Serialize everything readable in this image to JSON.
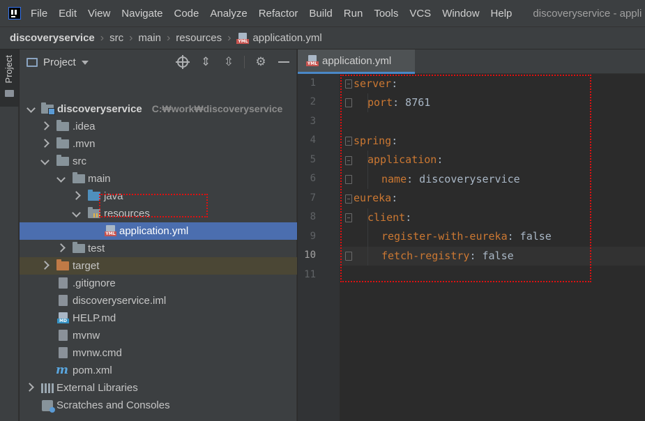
{
  "menubar": {
    "items": [
      "File",
      "Edit",
      "View",
      "Navigate",
      "Code",
      "Analyze",
      "Refactor",
      "Build",
      "Run",
      "Tools",
      "VCS",
      "Window",
      "Help"
    ],
    "window_title": "discoveryservice - appli"
  },
  "breadcrumb": {
    "items": [
      "discoveryservice",
      "src",
      "main",
      "resources",
      "application.yml"
    ]
  },
  "left_stripe": {
    "label": "Project"
  },
  "project_panel": {
    "title": "Project",
    "tree": [
      {
        "label": "discoveryservice",
        "path": "C:₩work₩discoveryservice",
        "icon": "module-folder-icon",
        "expanded": true
      },
      {
        "label": ".idea",
        "icon": "folder-icon",
        "expanded": false
      },
      {
        "label": ".mvn",
        "icon": "folder-icon",
        "expanded": false
      },
      {
        "label": "src",
        "icon": "folder-icon",
        "expanded": true
      },
      {
        "label": "main",
        "icon": "folder-icon",
        "expanded": true
      },
      {
        "label": "java",
        "icon": "source-folder-icon",
        "expanded": false
      },
      {
        "label": "resources",
        "icon": "resources-folder-icon",
        "expanded": true
      },
      {
        "label": "application.yml",
        "icon": "yml-file-icon",
        "selected": true
      },
      {
        "label": "test",
        "icon": "folder-icon",
        "expanded": false
      },
      {
        "label": "target",
        "icon": "excluded-folder-icon",
        "expanded": false
      },
      {
        "label": ".gitignore",
        "icon": "gitignore-file-icon"
      },
      {
        "label": "discoveryservice.iml",
        "icon": "iml-file-icon"
      },
      {
        "label": "HELP.md",
        "icon": "md-file-icon"
      },
      {
        "label": "mvnw",
        "icon": "shell-file-icon"
      },
      {
        "label": "mvnw.cmd",
        "icon": "cmd-file-icon"
      },
      {
        "label": "pom.xml",
        "icon": "maven-icon"
      },
      {
        "label": "External Libraries",
        "icon": "libraries-icon",
        "expanded": false
      },
      {
        "label": "Scratches and Consoles",
        "icon": "scratches-icon"
      }
    ]
  },
  "editor": {
    "tab_label": "application.yml",
    "yml_tag": "YML",
    "md_tag": "MD",
    "current_line": 10,
    "line_numbers": [
      "1",
      "2",
      "3",
      "4",
      "5",
      "6",
      "7",
      "8",
      "9",
      "10",
      "11"
    ],
    "lines": [
      {
        "key": "server",
        "sep": ":",
        "value": ""
      },
      {
        "key": "port",
        "sep": ":",
        "value": " 8761"
      },
      {
        "key": "",
        "sep": "",
        "value": ""
      },
      {
        "key": "spring",
        "sep": ":",
        "value": ""
      },
      {
        "key": "application",
        "sep": ":",
        "value": ""
      },
      {
        "key": "name",
        "sep": ":",
        "value": " discoveryservice"
      },
      {
        "key": "eureka",
        "sep": ":",
        "value": ""
      },
      {
        "key": "client",
        "sep": ":",
        "value": ""
      },
      {
        "key": "register-with-eureka",
        "sep": ":",
        "value": " false"
      },
      {
        "key": "fetch-registry",
        "sep": ":",
        "value": " false"
      },
      {
        "key": "",
        "sep": "",
        "value": ""
      }
    ]
  },
  "colors": {
    "keyword": "#cc7832",
    "text": "#a9b7c6",
    "selection": "#4b6eaf",
    "annotation": "#e01010"
  }
}
